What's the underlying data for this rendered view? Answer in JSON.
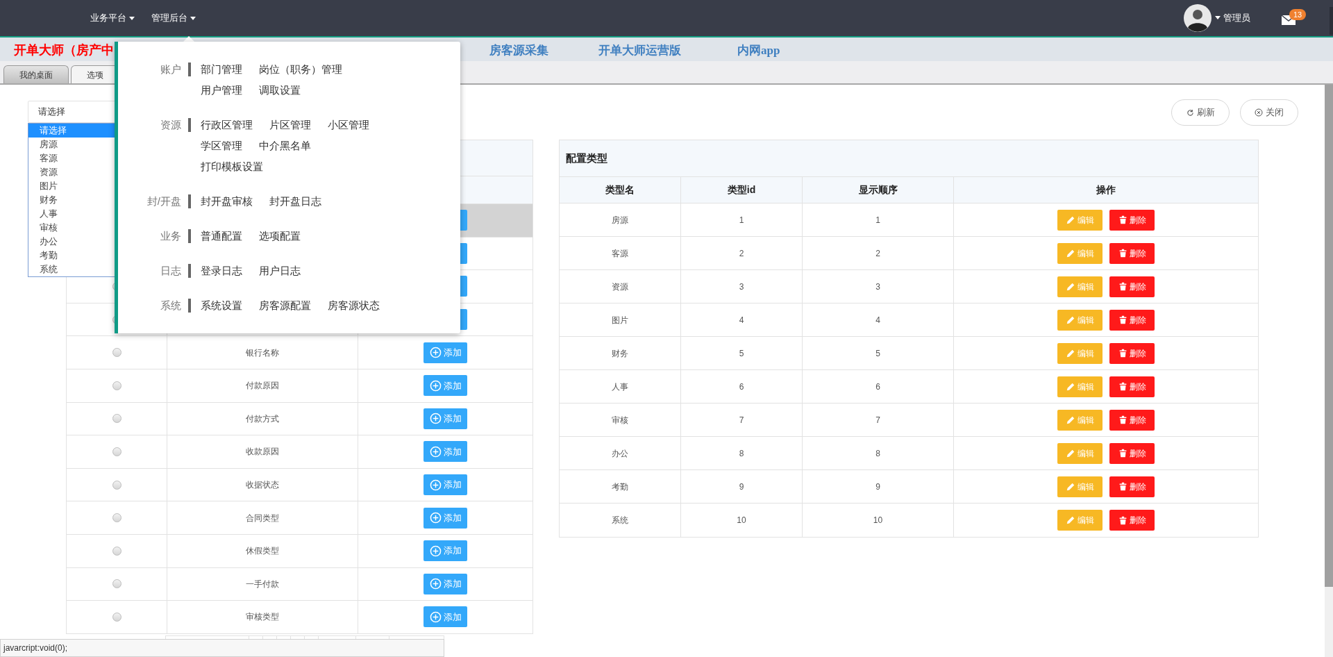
{
  "top_nav": {
    "items": [
      {
        "label": "业务平台"
      },
      {
        "label": "管理后台"
      }
    ],
    "user": {
      "name": "管理员"
    },
    "mail_badge": "13"
  },
  "sub_nav": {
    "brand": "开单大师（房产中",
    "links": [
      "房客源采集",
      "开单大师运营版",
      "内网app"
    ]
  },
  "page_tabs": [
    {
      "label": "我的桌面",
      "selected": false
    },
    {
      "label": "选项",
      "selected": true
    }
  ],
  "select": {
    "value": "请选择",
    "options": [
      {
        "label": "请选择",
        "selected": true
      },
      {
        "label": "房源",
        "selected": false
      },
      {
        "label": "客源",
        "selected": false
      },
      {
        "label": "资源",
        "selected": false
      },
      {
        "label": "图片",
        "selected": false
      },
      {
        "label": "财务",
        "selected": false
      },
      {
        "label": "人事",
        "selected": false
      },
      {
        "label": "审核",
        "selected": false
      },
      {
        "label": "办公",
        "selected": false
      },
      {
        "label": "考勤",
        "selected": false
      },
      {
        "label": "系统",
        "selected": false
      }
    ]
  },
  "toolbar": {
    "buttons": [
      {
        "kind": "refresh",
        "label": "刷新"
      },
      {
        "kind": "close",
        "label": "关闭"
      }
    ]
  },
  "left_table": {
    "rows": [
      {
        "selected": true
      },
      {
        "selected": false
      },
      {
        "selected": false,
        "radio": true
      },
      {
        "selected": false,
        "radio": true
      },
      {
        "name": "银行名称",
        "selected": false,
        "radio": true,
        "button": "添加"
      },
      {
        "name": "付款原因",
        "selected": false,
        "radio": true,
        "button": "添加"
      },
      {
        "name": "付款方式",
        "selected": false,
        "radio": true,
        "button": "添加"
      },
      {
        "name": "收款原因",
        "selected": false,
        "radio": true,
        "button": "添加"
      },
      {
        "name": "收据状态",
        "selected": false,
        "radio": true,
        "button": "添加"
      },
      {
        "name": "合同类型",
        "selected": false,
        "radio": true,
        "button": "添加"
      },
      {
        "name": "休假类型",
        "selected": false,
        "radio": true,
        "button": "添加"
      },
      {
        "name": "一手付款",
        "selected": false,
        "radio": true,
        "button": "添加"
      },
      {
        "name": "审核类型",
        "selected": false,
        "radio": true,
        "button": "添加"
      }
    ]
  },
  "right_table": {
    "title": "配置类型",
    "columns": [
      "类型名",
      "类型id",
      "显示顺序",
      "操作"
    ],
    "rows": [
      {
        "name": "房源",
        "id": "1",
        "order": "1",
        "actions": [
          "编辑",
          "删除"
        ]
      },
      {
        "name": "客源",
        "id": "2",
        "order": "2",
        "actions": [
          "编辑",
          "删除"
        ]
      },
      {
        "name": "资源",
        "id": "3",
        "order": "3",
        "actions": [
          "编辑",
          "删除"
        ]
      },
      {
        "name": "图片",
        "id": "4",
        "order": "4",
        "actions": [
          "编辑",
          "删除"
        ]
      },
      {
        "name": "财务",
        "id": "5",
        "order": "5",
        "actions": [
          "编辑",
          "删除"
        ]
      },
      {
        "name": "人事",
        "id": "6",
        "order": "6",
        "actions": [
          "编辑",
          "删除"
        ]
      },
      {
        "name": "审核",
        "id": "7",
        "order": "7",
        "actions": [
          "编辑",
          "删除"
        ]
      },
      {
        "name": "办公",
        "id": "8",
        "order": "8",
        "actions": [
          "编辑",
          "删除"
        ]
      },
      {
        "name": "考勤",
        "id": "9",
        "order": "9",
        "actions": [
          "编辑",
          "删除"
        ]
      },
      {
        "name": "系统",
        "id": "10",
        "order": "10",
        "actions": [
          "编辑",
          "删除"
        ]
      }
    ]
  },
  "admin_menu": {
    "groups": [
      {
        "label": "账户",
        "items": [
          "部门管理",
          "岗位（职务）管理",
          "用户管理",
          "调取设置"
        ]
      },
      {
        "label": "资源",
        "items": [
          "行政区管理",
          "片区管理",
          "小区管理",
          "学区管理",
          "中介黑名单",
          "打印模板设置"
        ]
      },
      {
        "label": "封/开盘",
        "items": [
          "封开盘审核",
          "封开盘日志"
        ]
      },
      {
        "label": "业务",
        "items": [
          "普通配置",
          "选项配置"
        ]
      },
      {
        "label": "日志",
        "items": [
          "登录日志",
          "用户日志"
        ]
      },
      {
        "label": "系统",
        "items": [
          "系统设置",
          "房客源配置",
          "房客源状态"
        ]
      }
    ]
  },
  "status_bar": "javarcript:void(0);"
}
